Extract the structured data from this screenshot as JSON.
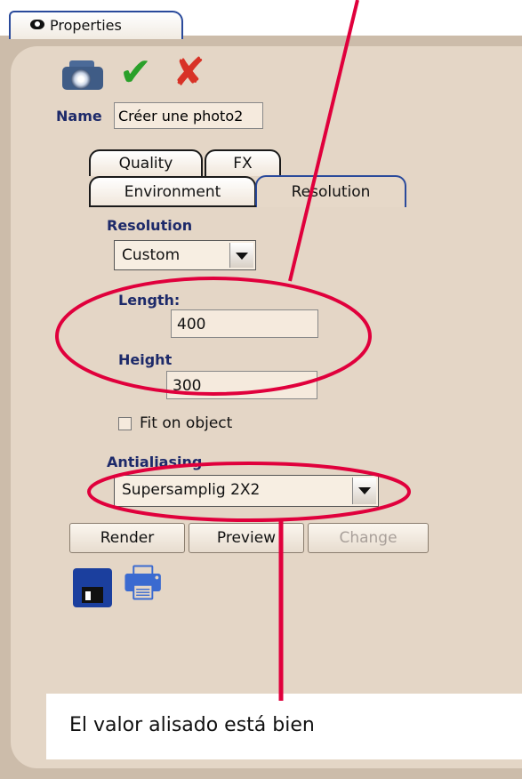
{
  "panel": {
    "tab_label": "Properties"
  },
  "toolbar": {
    "camera_icon": "camera-icon",
    "apply_icon": "checkmark-icon",
    "cancel_icon": "cross-icon"
  },
  "name": {
    "label": "Name",
    "value": "Créer une photo2"
  },
  "tabs": [
    {
      "label": "Quality"
    },
    {
      "label": "FX"
    },
    {
      "label": "Environment"
    },
    {
      "label": "Resolution",
      "selected": true
    }
  ],
  "resolution": {
    "section_label": "Resolution",
    "preset": "Custom",
    "length_label": "Length:",
    "length_value": "400",
    "height_label": "Height",
    "height_value": "300",
    "fit_label": "Fit on object",
    "fit_checked": false
  },
  "antialiasing": {
    "label": "Antialiasing",
    "value": "Supersamplig 2X2"
  },
  "buttons": {
    "render": "Render",
    "preview": "Preview",
    "change": "Change"
  },
  "annotation": {
    "text": "El valor alisado está bien",
    "color": "#e0003c"
  },
  "colors": {
    "panel_bg": "#e4d6c6",
    "label_blue": "#1d2a6a",
    "annotation_red": "#e0003c"
  }
}
